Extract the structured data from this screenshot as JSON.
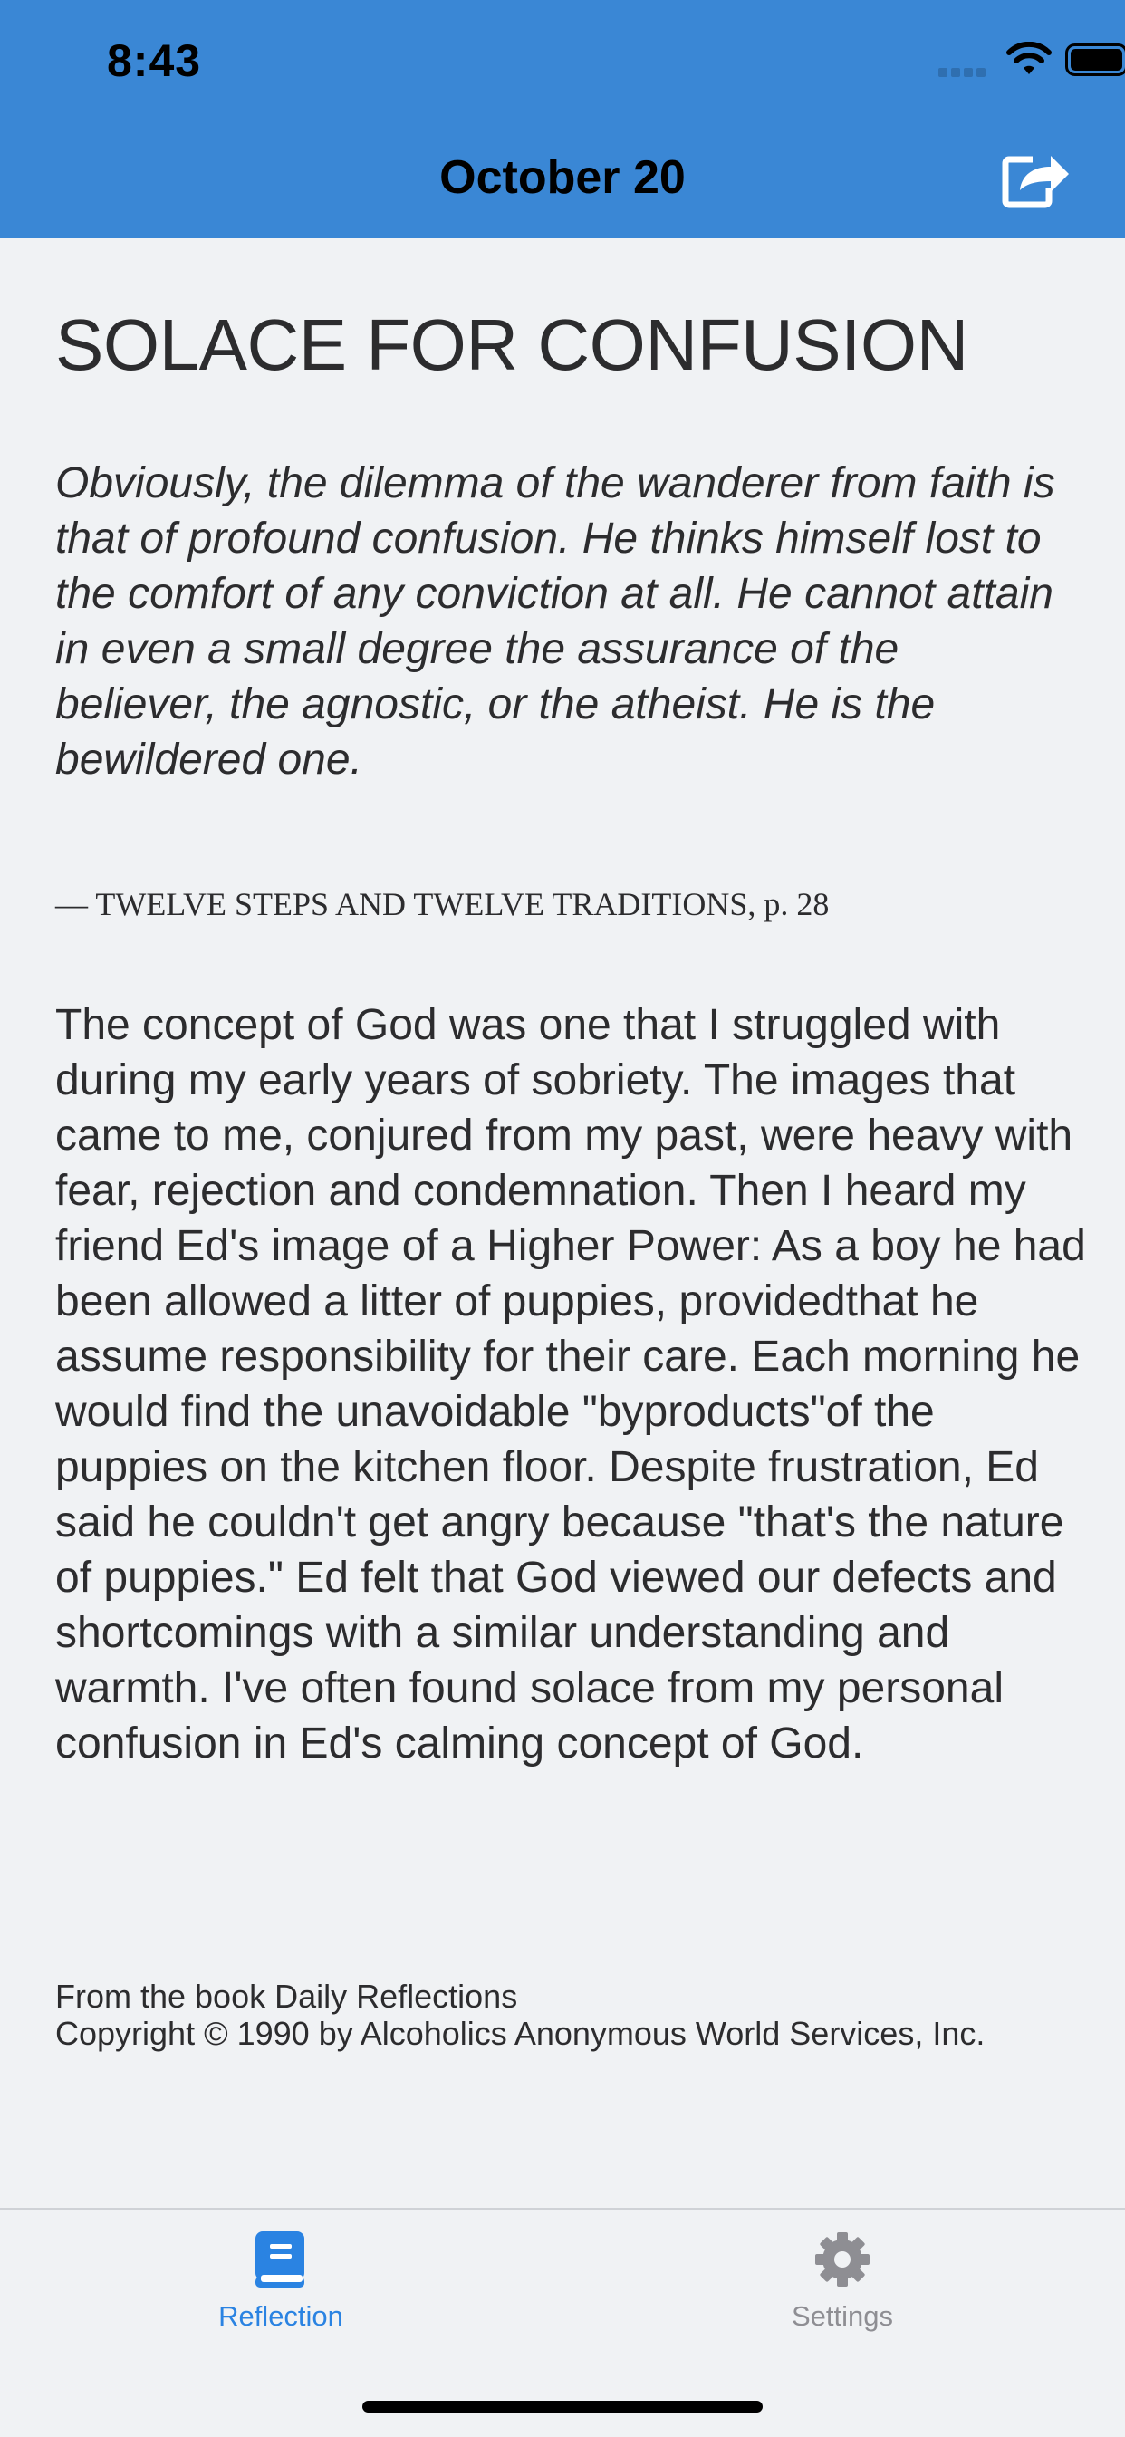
{
  "status_bar": {
    "time": "8:43",
    "icons": [
      "cellular-signal-icon",
      "wifi-icon",
      "battery-icon"
    ]
  },
  "nav": {
    "title": "October 20",
    "share_icon": "share-icon"
  },
  "reflection": {
    "title": "SOLACE FOR CONFUSION",
    "quote": "Obviously, the dilemma of the wanderer from faith is that of profound confusion. He thinks himself lost to the comfort of any conviction at all. He cannot attain in even a small degree the assurance of the believer, the agnostic, or the atheist. He is the bewildered one.",
    "source": "— TWELVE STEPS AND TWELVE TRADITIONS, p. 28",
    "body": "The concept of God was one that I struggled with during my early years of sobriety. The images that came to me, conjured from my past, were heavy with fear, rejection and condemnation. Then I heard my friend Ed's image of a Higher Power: As a boy he had been allowed a litter of puppies, providedthat he assume responsibility for their care. Each morning he would find the unavoidable \"byproducts\"of the puppies on the kitchen floor. Despite frustration, Ed said he couldn't get angry because \"that's the nature of puppies.\" Ed felt that God viewed our defects and shortcomings with a similar understanding and warmth. I've often found solace from my personal confusion in Ed's calming concept of God.",
    "footer_book": "From the book Daily Reflections",
    "footer_copyright": "Copyright © 1990 by Alcoholics Anonymous World Services, Inc."
  },
  "tabbar": {
    "tabs": [
      {
        "label": "Reflection",
        "icon": "book-icon",
        "active": true
      },
      {
        "label": "Settings",
        "icon": "gear-icon",
        "active": false
      }
    ]
  },
  "colors": {
    "header": "#3a87d5",
    "background": "#f0f2f4",
    "active_tab": "#2a83e2",
    "inactive_tab": "#8e8e93"
  }
}
